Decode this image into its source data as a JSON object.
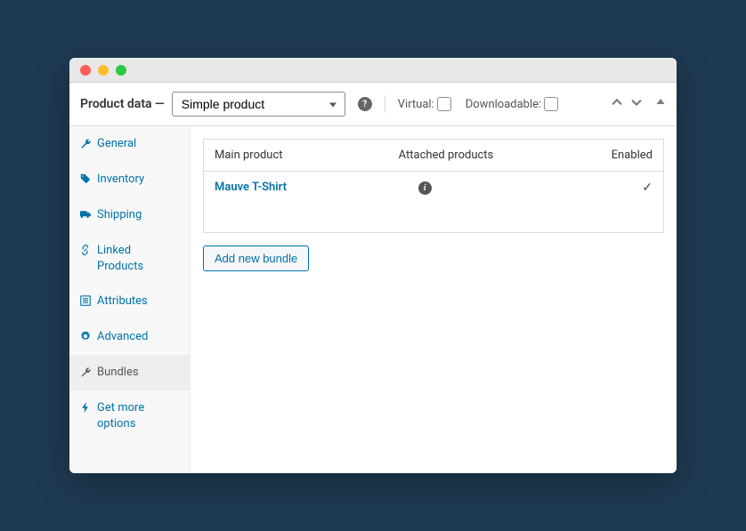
{
  "header": {
    "title": "Product data —",
    "product_type": "Simple product",
    "virtual_label": "Virtual:",
    "downloadable_label": "Downloadable:"
  },
  "sidebar": {
    "items": [
      {
        "label": "General",
        "icon": "wrench",
        "active": false
      },
      {
        "label": "Inventory",
        "icon": "tag",
        "active": false
      },
      {
        "label": "Shipping",
        "icon": "truck",
        "active": false
      },
      {
        "label": "Linked Products",
        "icon": "link",
        "active": false
      },
      {
        "label": "Attributes",
        "icon": "list",
        "active": false
      },
      {
        "label": "Advanced",
        "icon": "gear",
        "active": false
      },
      {
        "label": "Bundles",
        "icon": "wrench",
        "active": true
      },
      {
        "label": "Get more options",
        "icon": "bolt",
        "active": false
      }
    ]
  },
  "table": {
    "headers": {
      "main": "Main product",
      "attached": "Attached products",
      "enabled": "Enabled"
    },
    "rows": [
      {
        "main": "Mauve T-Shirt",
        "attached_info": true,
        "enabled": true
      }
    ]
  },
  "buttons": {
    "add_bundle": "Add new bundle"
  }
}
